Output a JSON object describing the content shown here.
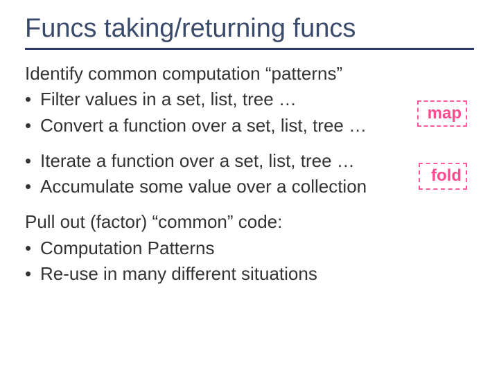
{
  "title": "Funcs taking/returning funcs",
  "intro": "Identify common computation “patterns”",
  "bullets_a": [
    "Filter values in a set, list, tree …",
    "Convert a function over a set, list, tree …"
  ],
  "bullets_b": [
    "Iterate a function over a set, list, tree …",
    "Accumulate some value over a collection"
  ],
  "tags": {
    "map": "map",
    "fold": "fold"
  },
  "outro": "Pull out (factor) “common” code:",
  "bullets_c": [
    "Computation Patterns",
    "Re-use in many different situations"
  ]
}
